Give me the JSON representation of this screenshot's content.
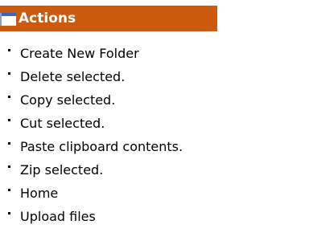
{
  "panel": {
    "title": "Actions",
    "header_color": "#cc5a0e",
    "header_icon": "window-icon"
  },
  "actions": [
    {
      "label": "Create New Folder"
    },
    {
      "label": "Delete selected."
    },
    {
      "label": "Copy selected."
    },
    {
      "label": "Cut selected."
    },
    {
      "label": "Paste clipboard contents."
    },
    {
      "label": "Zip selected."
    },
    {
      "label": "Home"
    },
    {
      "label": "Upload files"
    }
  ]
}
